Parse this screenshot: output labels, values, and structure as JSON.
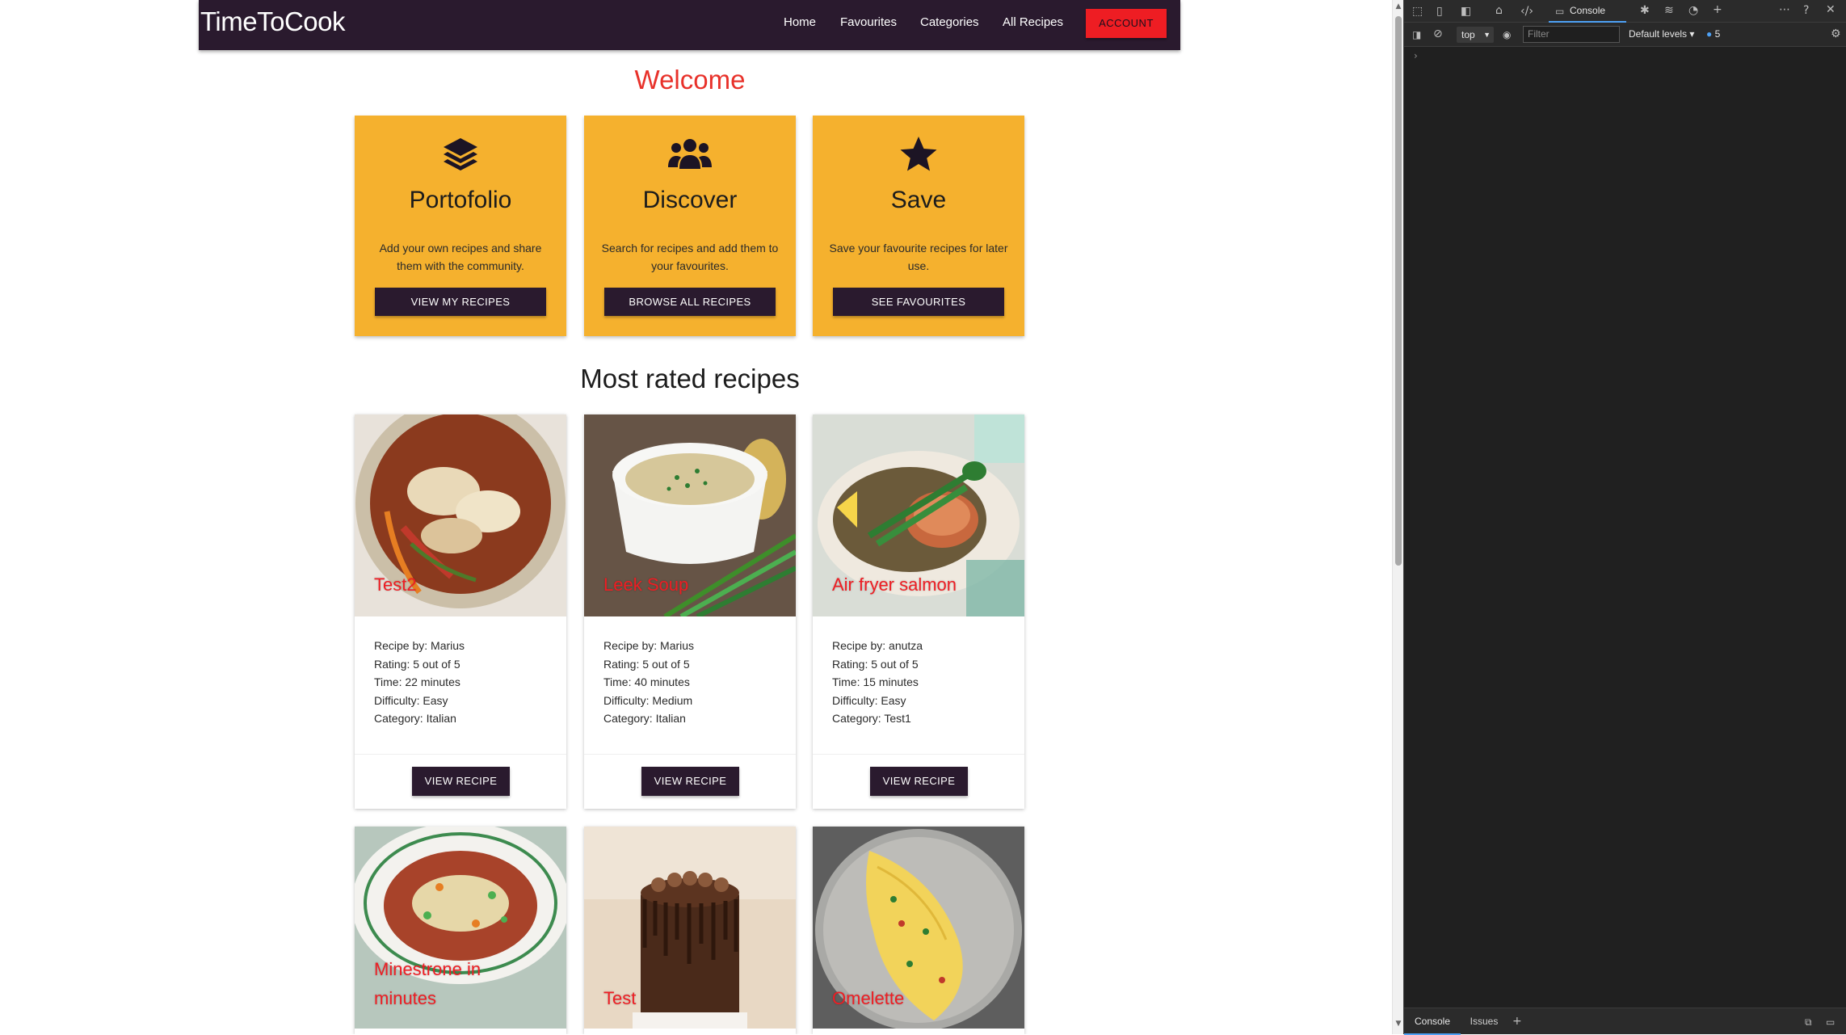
{
  "navbar": {
    "brand": "TimeToCook",
    "links": [
      "Home",
      "Favourites",
      "Categories",
      "All Recipes"
    ],
    "account": "ACCOUNT"
  },
  "welcome": "Welcome",
  "features": [
    {
      "icon": "layers-icon",
      "title": "Portofolio",
      "text": "Add your own recipes and share them with the community.",
      "button": "VIEW MY RECIPES"
    },
    {
      "icon": "users-icon",
      "title": "Discover",
      "text": "Search for recipes and add them to your favourites.",
      "button": "BROWSE ALL RECIPES"
    },
    {
      "icon": "star-icon",
      "title": "Save",
      "text": "Save your favourite recipes for later use.",
      "button": "SEE FAVOURITES"
    }
  ],
  "most_rated_title": "Most rated recipes",
  "recipes": [
    {
      "title": "Test2",
      "by": "Recipe by: Marius",
      "rating": "Rating: 5 out of 5",
      "time": "Time: 22 minutes",
      "difficulty": "Difficulty: Easy",
      "category": "Category: Italian",
      "button": "VIEW RECIPE"
    },
    {
      "title": "Leek Soup",
      "by": "Recipe by: Marius",
      "rating": "Rating: 5 out of 5",
      "time": "Time: 40 minutes",
      "difficulty": "Difficulty: Medium",
      "category": "Category: Italian",
      "button": "VIEW RECIPE"
    },
    {
      "title": "Air fryer salmon",
      "by": "Recipe by: anutza",
      "rating": "Rating: 5 out of 5",
      "time": "Time: 15 minutes",
      "difficulty": "Difficulty: Easy",
      "category": "Category: Test1",
      "button": "VIEW RECIPE"
    },
    {
      "title": "Minestrone in minutes"
    },
    {
      "title": "Test"
    },
    {
      "title": "Omelette"
    }
  ],
  "colors": {
    "navbar": "#2a1a2e",
    "accent_red": "#ee1d23",
    "feature_bg": "#f5b12e",
    "button_dark": "#2a1a2e"
  },
  "devtools": {
    "active_tab": "Console",
    "context": "top",
    "filter_placeholder": "Filter",
    "levels": "Default levels",
    "message_count": "5",
    "bottom_tabs": [
      "Console",
      "Issues"
    ]
  }
}
